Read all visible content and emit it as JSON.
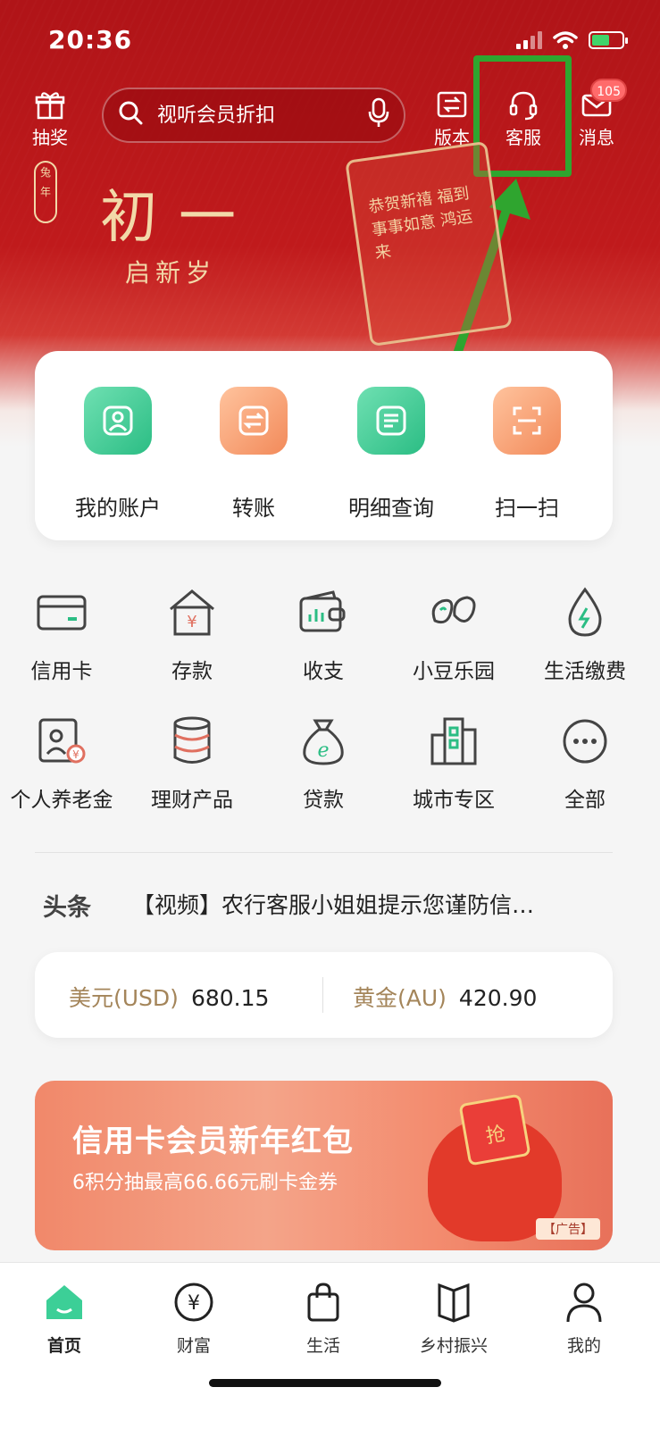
{
  "status_bar": {
    "time": "20:36"
  },
  "top_nav": {
    "lottery_label": "抽奖",
    "search_placeholder": "视听会员折扣",
    "version_label": "版本",
    "service_label": "客服",
    "message_label": "消息",
    "message_badge": "105"
  },
  "banner": {
    "title": "初一",
    "subtitle": "启新岁",
    "envelope_text": "恭贺新禧 福到 事事如意 鸿运来"
  },
  "quick_actions": [
    {
      "label": "我的账户",
      "icon": "account-icon",
      "color": "green"
    },
    {
      "label": "转账",
      "icon": "transfer-icon",
      "color": "orange"
    },
    {
      "label": "明细查询",
      "icon": "details-icon",
      "color": "green"
    },
    {
      "label": "扫一扫",
      "icon": "scan-icon",
      "color": "orange"
    }
  ],
  "services": [
    {
      "label": "信用卡",
      "icon": "credit-card-icon"
    },
    {
      "label": "存款",
      "icon": "deposit-icon"
    },
    {
      "label": "收支",
      "icon": "wallet-icon"
    },
    {
      "label": "小豆乐园",
      "icon": "bean-icon"
    },
    {
      "label": "生活缴费",
      "icon": "water-drop-icon"
    },
    {
      "label": "个人养老金",
      "icon": "pension-icon"
    },
    {
      "label": "理财产品",
      "icon": "coin-stack-icon"
    },
    {
      "label": "贷款",
      "icon": "money-bag-icon"
    },
    {
      "label": "城市专区",
      "icon": "city-icon"
    },
    {
      "label": "全部",
      "icon": "more-icon"
    }
  ],
  "headline": {
    "tag": "头条",
    "text": "【视频】农行客服小姐姐提示您谨防信…"
  },
  "rates": {
    "usd_label": "美元(USD)",
    "usd_value": "680.15",
    "gold_label": "黄金(AU)",
    "gold_value": "420.90"
  },
  "ad": {
    "title": "信用卡会员新年红包",
    "subtitle": "6积分抽最高66.66元刷卡金券",
    "tag": "【广告】",
    "envelope_text": "抢"
  },
  "tabbar": [
    {
      "label": "首页",
      "icon": "home-icon",
      "active": true
    },
    {
      "label": "财富",
      "icon": "yen-icon",
      "active": false
    },
    {
      "label": "生活",
      "icon": "shopping-bag-icon",
      "active": false
    },
    {
      "label": "乡村振兴",
      "icon": "book-icon",
      "active": false
    },
    {
      "label": "我的",
      "icon": "profile-icon",
      "active": false
    }
  ],
  "colors": {
    "brand_red": "#c01a1c",
    "accent_green": "#2bbd84",
    "accent_orange": "#f28a5a",
    "highlight_green": "#2fa52f"
  }
}
